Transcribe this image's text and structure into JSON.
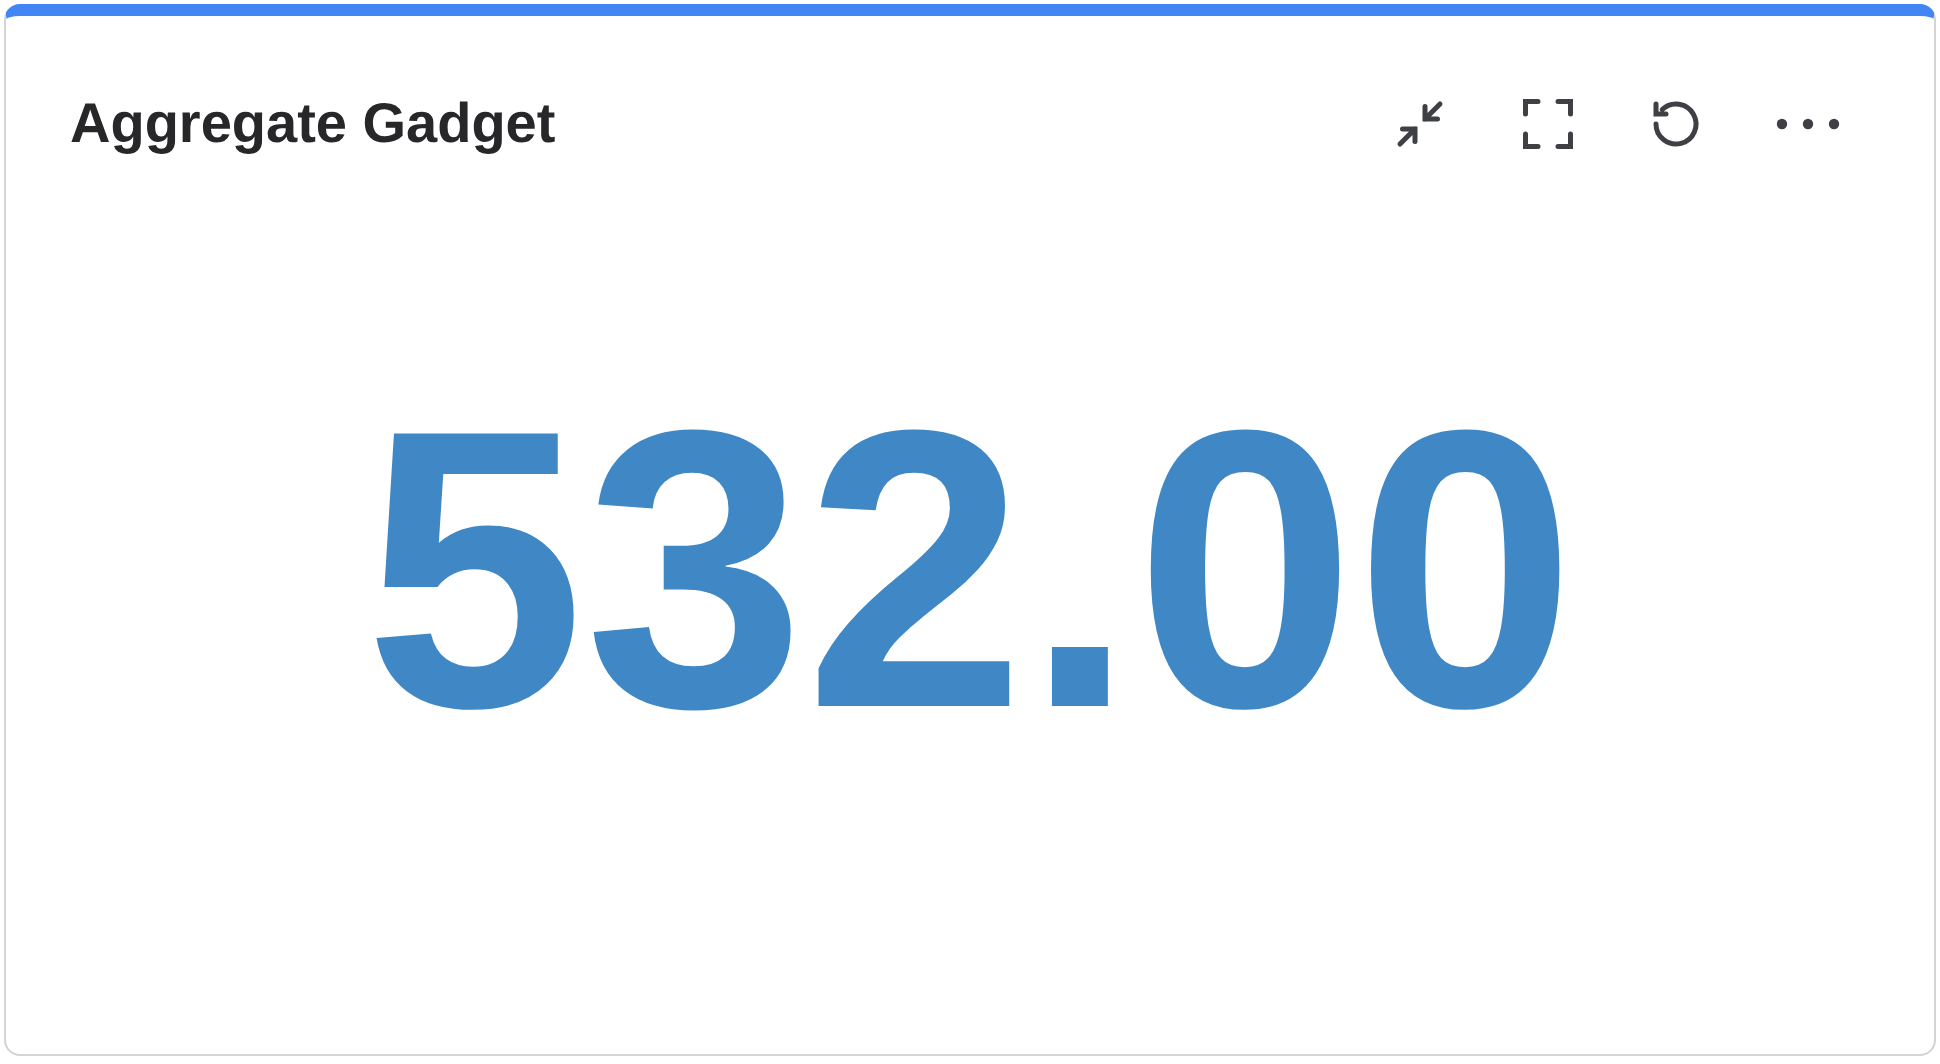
{
  "gadget": {
    "title": "Aggregate Gadget",
    "value": "532.00"
  }
}
